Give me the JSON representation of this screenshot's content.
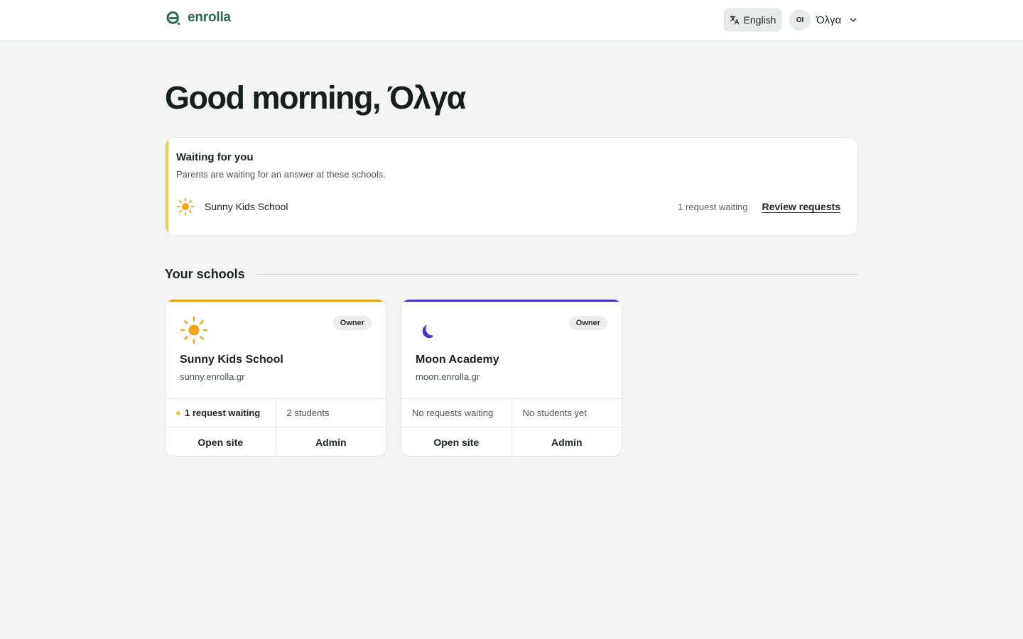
{
  "header": {
    "brand": "enrolla",
    "language_label": "English",
    "user_initials": "OI",
    "user_name": "Όλγα"
  },
  "greeting": "Good morning, Όλγα",
  "waiting": {
    "title": "Waiting for you",
    "subtitle": "Parents are waiting for an answer at these schools.",
    "items": [
      {
        "school": "Sunny Kids School",
        "count_label": "1 request waiting",
        "action_label": "Review requests"
      }
    ]
  },
  "schools_section": {
    "title": "Your schools"
  },
  "schools": [
    {
      "name": "Sunny Kids School",
      "domain": "sunny.enrolla.gr",
      "role": "Owner",
      "emblem": "sun-icon",
      "accent": "#f2a516",
      "requests_label": "1 request waiting",
      "students_label": "2 students",
      "open_label": "Open site",
      "admin_label": "Admin"
    },
    {
      "name": "Moon Academy",
      "domain": "moon.enrolla.gr",
      "role": "Owner",
      "emblem": "moon-icon",
      "accent": "#4a35c9",
      "requests_label": "No requests waiting",
      "students_label": "No students yet",
      "open_label": "Open site",
      "admin_label": "Admin"
    }
  ],
  "colors": {
    "brand": "#2a6a4f",
    "pending": "#f7c948",
    "background": "#f3f5f4"
  }
}
